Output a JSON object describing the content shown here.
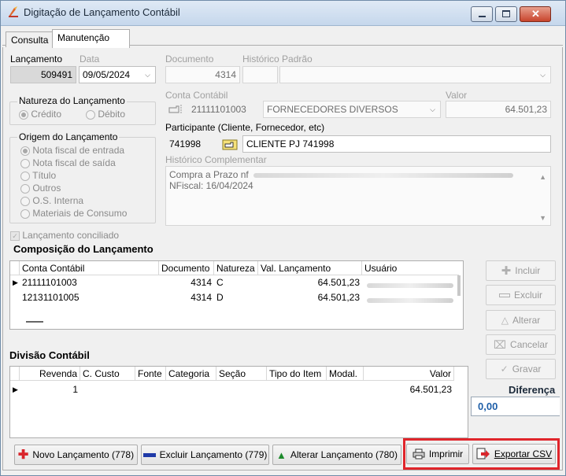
{
  "window": {
    "title": "Digitação de Lançamento Contábil"
  },
  "tabs": [
    {
      "label": "Consulta"
    },
    {
      "label": "Manutenção"
    }
  ],
  "header": {
    "lancamento_label": "Lançamento",
    "lancamento_value": "509491",
    "data_label": "Data",
    "data_value": "09/05/2024",
    "documento_label": "Documento",
    "documento_value": "4314",
    "historico_padrao_label": "Histórico Padrão",
    "conta_label": "Conta Contábil",
    "conta_code": "21111101003",
    "conta_name": "FORNECEDORES DIVERSOS",
    "valor_label": "Valor",
    "valor_value": "64.501,23",
    "participante_label": "Participante (Cliente, Fornecedor, etc)",
    "participante_code": "741998",
    "participante_name": "CLIENTE PJ 741998",
    "historico_comp_label": "Histórico Complementar",
    "historico_line1": "Compra a Prazo nf",
    "historico_line2": "NFiscal: 16/04/2024"
  },
  "natureza": {
    "title": "Natureza do Lançamento",
    "options": [
      "Crédito",
      "Débito"
    ]
  },
  "origem": {
    "title": "Origem do Lançamento",
    "options": [
      "Nota fiscal de entrada",
      "Nota fiscal de saída",
      "Título",
      "Outros",
      "O.S. Interna",
      "Materiais de Consumo"
    ]
  },
  "conciliado_label": "Lançamento conciliado",
  "composicao": {
    "title": "Composição do Lançamento",
    "columns": [
      "Conta Contábil",
      "Documento",
      "Natureza",
      "Val. Lançamento",
      "Usuário"
    ],
    "rows": [
      {
        "conta": "21111101003",
        "documento": "4314",
        "natureza": "C",
        "valor": "64.501,23"
      },
      {
        "conta": "12131101005",
        "documento": "4314",
        "natureza": "D",
        "valor": "64.501,23"
      }
    ]
  },
  "side_buttons": {
    "incluir": "Incluir",
    "excluir": "Excluir",
    "alterar": "Alterar",
    "cancelar": "Cancelar",
    "gravar": "Gravar"
  },
  "divisao": {
    "title": "Divisão Contábil",
    "columns": [
      "Revenda",
      "C. Custo",
      "Fonte",
      "Categoria",
      "Seção",
      "Tipo do Item",
      "Modal.",
      "Valor"
    ],
    "rows": [
      {
        "revenda": "1",
        "valor": "64.501,23"
      }
    ]
  },
  "diferenca": {
    "label": "Diferença",
    "value": "0,00"
  },
  "bottom": {
    "novo": "Novo Lançamento (778)",
    "excluir": "Excluir Lançamento (779)",
    "alterar": "Alterar Lançamento (780)",
    "imprimir": "Imprimir",
    "exportar": "Exportar CSV"
  },
  "colors": {
    "highlight": "#e0252b",
    "novo_icon": "#d9262c",
    "excluir_icon": "#1f3aa8",
    "alterar_icon": "#1d8a2c",
    "diferenca": "#1f5fa8"
  }
}
